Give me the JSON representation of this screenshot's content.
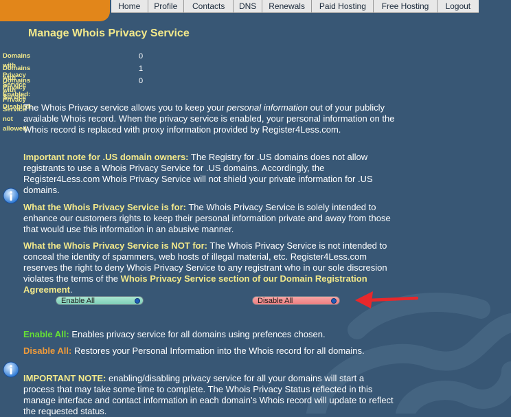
{
  "nav": [
    "Home",
    "Profile",
    "Contacts",
    "DNS",
    "Renewals",
    "Paid Hosting",
    "Free Hosting",
    "Logout"
  ],
  "title": "Manage Whois Privacy Service",
  "stats": [
    {
      "label": "Domains with Privacy Service Enabled:",
      "value": "0"
    },
    {
      "label": "Domains with Privacy Service Disabled:",
      "value": "1"
    },
    {
      "label": "Domains with Privacy Service not allowed:",
      "value": "0"
    }
  ],
  "info": {
    "intro_a": "The Whois Privacy service allows you to keep your ",
    "intro_em": "personal information",
    "intro_b": " out of your publicly available Whois record. When the privacy service is enabled, your personal information on the Whois record is replaced with proxy information provided by Register4Less.com.",
    "us_head": "Important note for .US domain owners:",
    "us_text": " The Registry for .US domains does not allow registrants to use a Whois Privacy Service for .US domains. Accordingly, the Register4Less.com Whois Privacy Service will not shield your private information for .US domains.",
    "for_head": "What the Whois Privacy Service is for:",
    "for_text": " The Whois Privacy Service is solely intended to enhance our customers rights to keep their personal information private and away from those that would use this information in an abusive manner.",
    "notfor_head": "What the Whois Privacy Service is NOT for:",
    "notfor_text": " The Whois Privacy Service is not intended to conceal the identity of spammers, web hosts of illegal material, etc. Register4Less.com reserves the right to deny Whois Privacy Service to any registrant who in our sole discresion violates the terms of the ",
    "notfor_link": "Whois Privacy Service section of our Domain Registration Agreement",
    "notfor_end": "."
  },
  "buttons": {
    "enable": "Enable All",
    "disable": "Disable All"
  },
  "help": {
    "enable_head": "Enable All:",
    "enable_text": " Enables privacy service for all domains using prefences chosen.",
    "disable_head": "Disable All:",
    "disable_text": " Restores your Personal Information into the Whois record for all domains.",
    "note_head": "IMPORTANT NOTE:",
    "note_text": " enabling/disabling privacy service for all your domains will start a process that may take some time to complete. The Whois Privacy Status reflected in this manage interface and contact information in each domain's Whois record will update to reflect the requested status."
  },
  "colors": {
    "background": "#385775",
    "accent": "#e2861a",
    "highlight": "#f3e98b",
    "enable": "#65e035",
    "disable": "#f09b3a",
    "arrow": "#e8282b"
  }
}
